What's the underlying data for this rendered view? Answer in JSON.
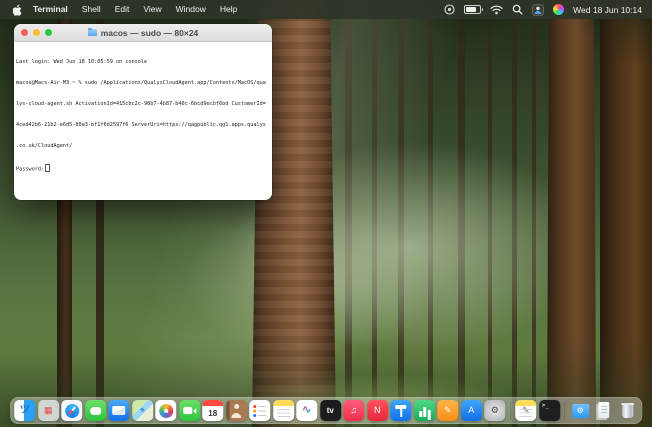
{
  "menu_bar": {
    "app_name": "Terminal",
    "menus": [
      "Shell",
      "Edit",
      "View",
      "Window",
      "Help"
    ],
    "clock": "Wed 18 Jun 10:14",
    "status_icons": [
      "menu-extra",
      "battery",
      "wifi",
      "spotlight",
      "user-switch",
      "siri"
    ]
  },
  "terminal": {
    "title": "macos — sudo — 80×24",
    "lines": [
      "Last login: Wed Jun 18 10:05:59 on console",
      "macos@Macs-Air-M3 ~ % sudo /Applications/QualysCloudAgent.app/Contents/MacOS/qua",
      "lys-cloud-agent.sh ActivationId=415cbc2c-90b7-4b87-b40c-6bcd9ecbf6bd CustomerId=",
      "4ced42b6-21b2-e6d5-80a3-bf1f6d2597f6 ServerUri=https://qagpublic.qg1.apps.qualys",
      ".co.uk/CloudAgent/"
    ],
    "prompt": "Password:",
    "background": "#ffffff",
    "text_color": "#1c1c1c"
  },
  "dock": {
    "items": [
      {
        "name": "finder",
        "label": "Finder",
        "kind": "finder",
        "bg": "linear-gradient(90deg,#ffffff 0 46%,#2aa0f2 46% 100%)",
        "glyph": "ツ",
        "fg": "#1b6fc0"
      },
      {
        "name": "launchpad",
        "label": "Launchpad",
        "kind": "glyph",
        "bg": "rgba(235,238,240,.75)",
        "glyph": "▦",
        "fg": "#e8484b"
      },
      {
        "name": "safari",
        "label": "Safari",
        "kind": "safari",
        "bg": "#f5f6f7",
        "glyph": ""
      },
      {
        "name": "messages",
        "label": "Messages",
        "kind": "bubble",
        "bg": "linear-gradient(#6ce06a,#2fc33c)",
        "glyph": ""
      },
      {
        "name": "mail",
        "label": "Mail",
        "kind": "envelope",
        "bg": "linear-gradient(#4aa8f8,#1470e6)",
        "glyph": ""
      },
      {
        "name": "maps",
        "label": "Maps",
        "kind": "glyph",
        "bg": "linear-gradient(135deg,#cfe8a8 0 38%,#9fd7f2 38% 58%,#e9f0d9 58% 100%)",
        "glyph": "⌖",
        "fg": "#1470e6"
      },
      {
        "name": "photos",
        "label": "Photos",
        "kind": "photos",
        "bg": "#ffffff",
        "glyph": ""
      },
      {
        "name": "facetime",
        "label": "FaceTime",
        "kind": "camera",
        "bg": "linear-gradient(#6ce06a,#2fc33c)",
        "glyph": ""
      },
      {
        "name": "calendar",
        "label": "Calendar",
        "kind": "calendar",
        "bg": "#ffffff",
        "day": "18"
      },
      {
        "name": "contacts",
        "label": "Contacts",
        "kind": "book",
        "bg": "linear-gradient(90deg,#7c5134 0 15%,#a97a52 15% 100%)",
        "glyph": ""
      },
      {
        "name": "reminders",
        "label": "Reminders",
        "kind": "reminders",
        "bg": "#ffffff",
        "glyph": ""
      },
      {
        "name": "notes",
        "label": "Notes",
        "kind": "notes",
        "bg": "#ffffff",
        "glyph": ""
      },
      {
        "name": "freeform",
        "label": "Freeform",
        "kind": "freeform",
        "bg": "#ffffff",
        "glyph": "∿"
      },
      {
        "name": "tv",
        "label": "Apple TV",
        "kind": "tv",
        "bg": "#1c1c1e",
        "glyph": "tv",
        "fg": "#ffffff"
      },
      {
        "name": "music",
        "label": "Music",
        "kind": "glyph",
        "bg": "linear-gradient(#fc5c7d,#f23049)",
        "glyph": "♫",
        "fg": "#ffffff"
      },
      {
        "name": "news",
        "label": "News",
        "kind": "glyph",
        "bg": "linear-gradient(#ff5460,#e5263d)",
        "glyph": "N",
        "fg": "#ffffff"
      },
      {
        "name": "keynote",
        "label": "Keynote",
        "kind": "keynote",
        "bg": "linear-gradient(#3ea6f8,#0f6fe8)",
        "glyph": ""
      },
      {
        "name": "numbers",
        "label": "Numbers",
        "kind": "chart",
        "bg": "linear-gradient(#4ed884,#16ad59)",
        "glyph": ""
      },
      {
        "name": "pages",
        "label": "Pages",
        "kind": "glyph",
        "bg": "linear-gradient(#ffb34a,#f78f15)",
        "glyph": "✎",
        "fg": "#ffffff"
      },
      {
        "name": "appstore",
        "label": "App Store",
        "kind": "glyph",
        "bg": "linear-gradient(#3ea6f8,#0f6fe8)",
        "glyph": "A",
        "fg": "#ffffff"
      },
      {
        "name": "settings",
        "label": "System Settings",
        "kind": "glyph",
        "bg": "radial-gradient(#e8e9eb,#aeb0b5)",
        "glyph": "⚙",
        "fg": "#4a4b4e"
      },
      {
        "name": "divider-1",
        "label": "",
        "kind": "divider"
      },
      {
        "name": "textedit",
        "label": "TextEdit",
        "kind": "notes",
        "bg": "#ffffff",
        "glyph": "✎",
        "fg": "#6a6a6a"
      },
      {
        "name": "terminal",
        "label": "Terminal",
        "kind": "terminal-app",
        "bg": "#1d1f21",
        "glyph": ">_",
        "fg": "#ffffff"
      },
      {
        "name": "divider-2",
        "label": "",
        "kind": "divider"
      },
      {
        "name": "applications-folder",
        "label": "Applications",
        "kind": "folder",
        "glyph": "⚙",
        "fg": "#ffffff"
      },
      {
        "name": "downloads",
        "label": "Downloads",
        "kind": "docs",
        "glyph": ""
      },
      {
        "name": "trash",
        "label": "Trash",
        "kind": "trash",
        "glyph": ""
      }
    ]
  },
  "colors": {
    "menubar_bg": "#2e3528",
    "accent_blue": "#2aa0f2",
    "traffic_red": "#ff5f57",
    "traffic_yellow": "#febc2e",
    "traffic_green": "#28c840",
    "calendar_red": "#fb4b43"
  }
}
